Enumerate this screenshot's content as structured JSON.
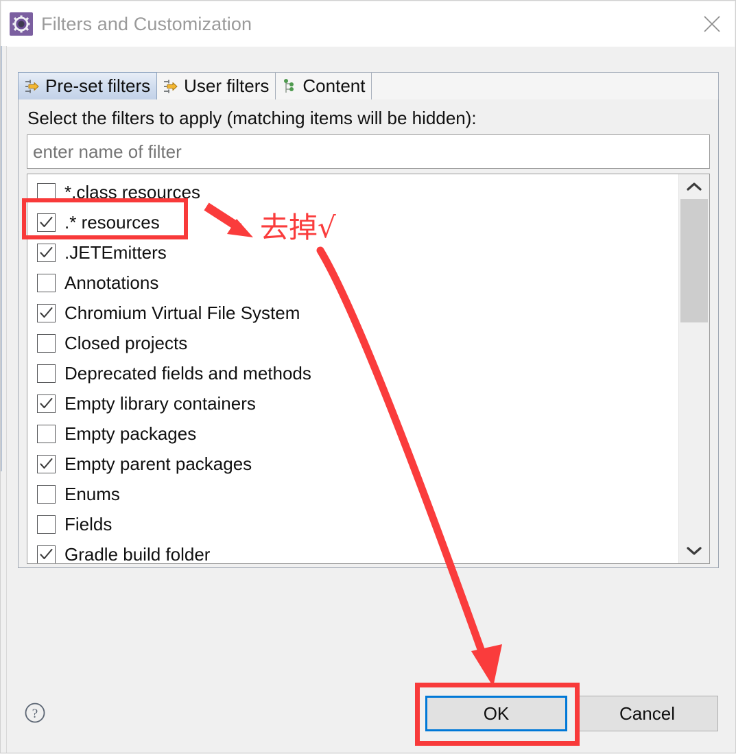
{
  "window": {
    "title": "Filters and Customization",
    "icon": "gear-icon",
    "close_label": "×"
  },
  "tabs": [
    {
      "label": "Pre-set filters",
      "icon": "filter-arrow-icon",
      "active": true
    },
    {
      "label": "User filters",
      "icon": "filter-arrow-icon",
      "active": false
    },
    {
      "label": "Content",
      "icon": "content-tree-icon",
      "active": false
    }
  ],
  "panel": {
    "instruction": "Select the filters to apply (matching items will be hidden):",
    "filter_input": {
      "value": "",
      "placeholder": "enter name of filter"
    }
  },
  "filter_list": [
    {
      "label": "*.class resources",
      "checked": false
    },
    {
      "label": ".* resources",
      "checked": true
    },
    {
      "label": ".JETEmitters",
      "checked": true
    },
    {
      "label": "Annotations",
      "checked": false
    },
    {
      "label": "Chromium Virtual File System",
      "checked": true
    },
    {
      "label": "Closed projects",
      "checked": false
    },
    {
      "label": "Deprecated fields and methods",
      "checked": false
    },
    {
      "label": "Empty library containers",
      "checked": true
    },
    {
      "label": "Empty packages",
      "checked": false
    },
    {
      "label": "Empty parent packages",
      "checked": true
    },
    {
      "label": "Enums",
      "checked": false
    },
    {
      "label": "Fields",
      "checked": false
    },
    {
      "label": "Gradle build folder",
      "checked": true
    }
  ],
  "scrollbar": {
    "up_arrow": "chevron-up-icon",
    "down_arrow": "chevron-down-icon"
  },
  "footer": {
    "help": "?",
    "ok_label": "OK",
    "cancel_label": "Cancel"
  },
  "annotations": {
    "note_text": "去掉√",
    "color": "#fa3c3c",
    "highlight_item": ".* resources",
    "highlight_button": "OK"
  }
}
